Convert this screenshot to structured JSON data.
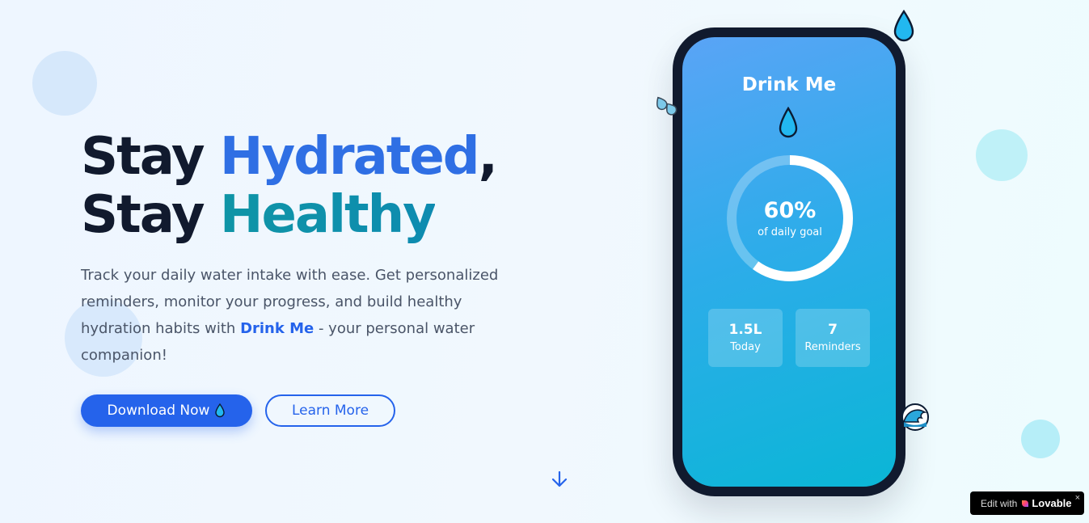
{
  "hero": {
    "line1_prefix": "Stay ",
    "line1_highlight": "Hydrated",
    "line1_suffix": ",",
    "line2_prefix": "Stay ",
    "line2_highlight": "Healthy",
    "description_before": "Track your daily water intake with ease. Get personalized reminders, monitor your progress, and build healthy hydration habits with ",
    "description_brand": "Drink Me",
    "description_after": " - your personal water companion!",
    "primary_button": "Download Now",
    "secondary_button": "Learn More"
  },
  "phone": {
    "app_title": "Drink Me",
    "progress_percent_text": "60%",
    "progress_fraction": 0.6,
    "progress_caption": "of daily goal",
    "stats": [
      {
        "value": "1.5L",
        "label": "Today"
      },
      {
        "value": "7",
        "label": "Reminders"
      }
    ]
  },
  "badge": {
    "prefix": "Edit with",
    "brand": "Lovable",
    "close": "×"
  },
  "icons": {
    "droplet": "droplet-icon",
    "sweat": "sweat-droplets-icon",
    "wave": "water-wave-icon",
    "scroll": "arrow-down-icon",
    "heart": "heart-logo-icon"
  },
  "colors": {
    "accent": "#2563eb",
    "teal": "#0f95a6",
    "heading": "#111a2e",
    "phone_frame": "#111a2e"
  }
}
